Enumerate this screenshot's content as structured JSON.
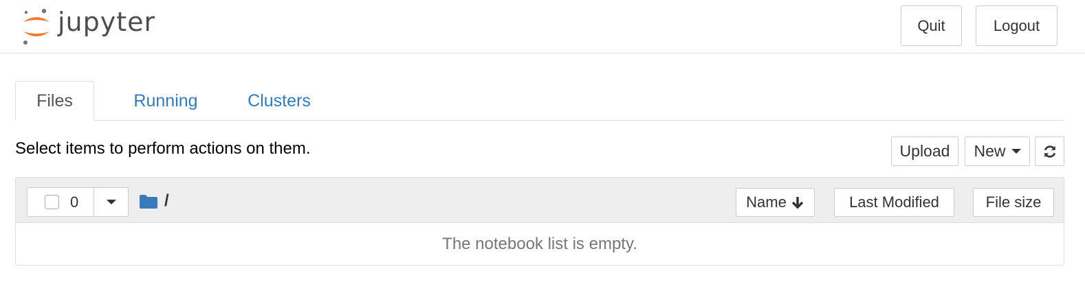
{
  "header": {
    "logo_text": "jupyter",
    "quit_label": "Quit",
    "logout_label": "Logout"
  },
  "tabs": [
    {
      "label": "Files",
      "active": true
    },
    {
      "label": "Running",
      "active": false
    },
    {
      "label": "Clusters",
      "active": false
    }
  ],
  "toolbar": {
    "instructions": "Select items to perform actions on them.",
    "upload_label": "Upload",
    "new_label": "New",
    "refresh_icon": "refresh-icon"
  },
  "file_list": {
    "selected_count": "0",
    "path_separator": "/",
    "folder_icon": "folder-icon",
    "columns": {
      "name": "Name",
      "last_modified": "Last Modified",
      "file_size": "File size"
    },
    "empty_message": "The notebook list is empty."
  },
  "colors": {
    "logo_orange": "#f37726",
    "logo_gray": "#767677",
    "link_blue": "#337ab7",
    "folder_blue": "#3a7ab8",
    "header_bg": "#eeeeee"
  }
}
